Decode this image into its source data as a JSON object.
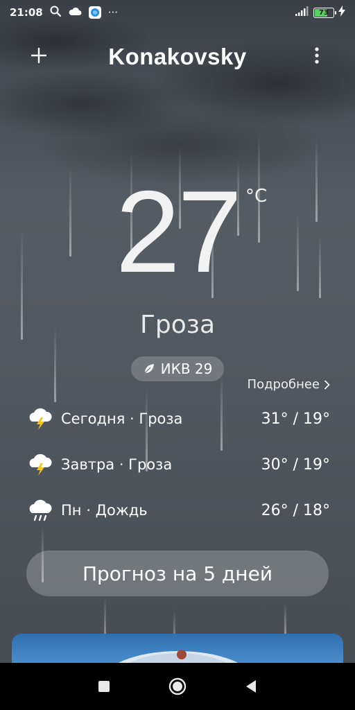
{
  "status_bar": {
    "time": "21:08",
    "more": "···",
    "battery_level": 73,
    "battery_text": "73",
    "battery_color": "#56d05f"
  },
  "header": {
    "add_icon": "plus-icon",
    "city": "Konakovsky",
    "menu_icon": "more-vertical-icon"
  },
  "current": {
    "temperature": "27",
    "unit": "°C",
    "condition": "Гроза",
    "aqi_label": "ИКВ 29",
    "aqi_icon": "leaf-icon"
  },
  "more_link": "Подробнее",
  "forecast": [
    {
      "day": "Сегодня",
      "condition": "Гроза",
      "high": "31°",
      "low": "19°",
      "icon": "thunderstorm-icon"
    },
    {
      "day": "Завтра",
      "condition": "Гроза",
      "high": "30°",
      "low": "19°",
      "icon": "thunderstorm-icon"
    },
    {
      "day": "Пн",
      "condition": "Дождь",
      "high": "26°",
      "low": "18°",
      "icon": "rain-cloud-icon"
    }
  ],
  "five_day_button": "Прогноз на 5 дней",
  "nav": {
    "recents_icon": "square-icon",
    "home_icon": "circle-icon",
    "back_icon": "triangle-back-icon"
  }
}
